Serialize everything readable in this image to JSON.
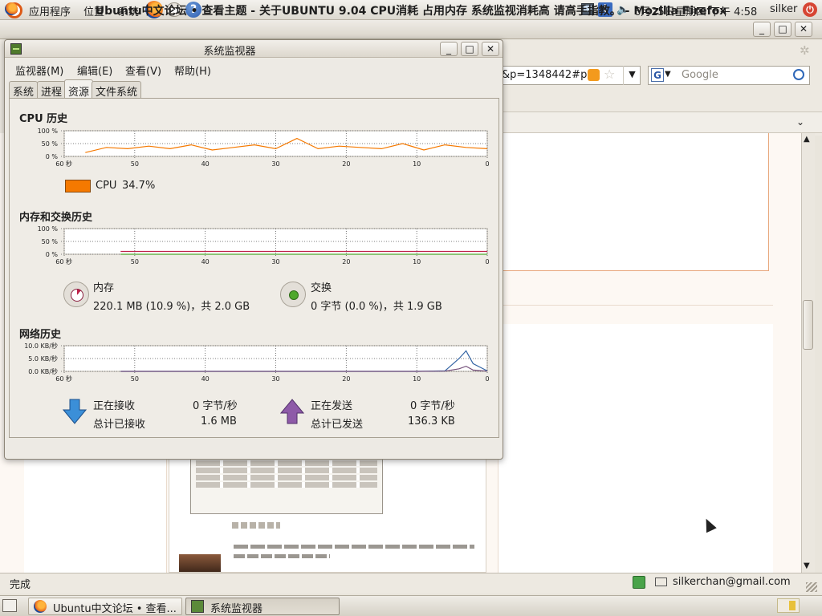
{
  "top_panel": {
    "menus": [
      "应用程序",
      "位置",
      "系统"
    ],
    "help_glyph": "?",
    "info_glyph": "i",
    "clock": "6月25日星期四 下午 4:58",
    "user": "silker",
    "icons": [
      "ubuntu-logo-icon",
      "firefox-icon",
      "mail-icon",
      "help-icon",
      "network-icon",
      "info-icon",
      "volume-icon",
      "power-icon"
    ]
  },
  "firefox": {
    "title": "Ubuntu中文论坛 • 查看主题 - 关于UBUNTU 9.04 CPU消耗 占用内存 系统监视消耗高 请高手指教。 - Mozilla Firefox",
    "url_tail": "&p=1348442#p",
    "search_placeholder": "Google",
    "status_text": "完成",
    "status_email": "silkerchan@gmail.com"
  },
  "window_buttons": {
    "minimize": "_",
    "maximize": "□",
    "close": "✕"
  },
  "taskbar": {
    "items": [
      {
        "label": "Ubuntu中文论坛 • 查看...",
        "active": false
      },
      {
        "label": "系统监视器",
        "active": true
      }
    ]
  },
  "system_monitor": {
    "title": "系统监视器",
    "menus": [
      "监视器(M)",
      "编辑(E)",
      "查看(V)",
      "帮助(H)"
    ],
    "tabs": [
      "系统",
      "进程",
      "资源",
      "文件系统"
    ],
    "active_tab": "资源",
    "cpu": {
      "title": "CPU 历史",
      "legend_label": "CPU",
      "legend_value": "34.7%",
      "color": "#f57900"
    },
    "memory": {
      "title": "内存和交换历史",
      "mem_label": "内存",
      "mem_value": "220.1 MB (10.9 %)，共 2.0 GB",
      "swap_label": "交换",
      "swap_value": "0 字节 (0.0 %)，共 1.9 GB",
      "mem_color": "#c0224b",
      "swap_color": "#4ea82c"
    },
    "network": {
      "title": "网络历史",
      "recv_label": "正在接收",
      "recv_rate": "0 字节/秒",
      "recv_total_label": "总计已接收",
      "recv_total": "1.6 MB",
      "send_label": "正在发送",
      "send_rate": "0 字节/秒",
      "send_total_label": "总计已发送",
      "send_total": "136.3 KB",
      "recv_color": "#3465a4",
      "send_color": "#75507b"
    }
  },
  "chart_data": [
    {
      "type": "line",
      "title": "CPU 历史",
      "x": [
        60,
        57,
        54,
        51,
        48,
        45,
        42,
        39,
        36,
        33,
        30,
        27,
        24,
        21,
        18,
        15,
        12,
        9,
        6,
        3,
        0
      ],
      "series": [
        {
          "name": "CPU",
          "values": [
            null,
            15,
            35,
            30,
            40,
            30,
            45,
            25,
            35,
            45,
            30,
            70,
            30,
            40,
            35,
            30,
            50,
            25,
            45,
            35,
            30
          ]
        }
      ],
      "xlabel": "",
      "ylabel": "",
      "x_tick_labels": [
        "60 秒",
        "50",
        "40",
        "30",
        "20",
        "10",
        "0"
      ],
      "y_tick_labels": [
        "100 %",
        "50 %",
        "0 %"
      ],
      "xlim": [
        60,
        0
      ],
      "ylim": [
        0,
        100
      ],
      "grid": true
    },
    {
      "type": "line",
      "title": "内存和交换历史",
      "x": [
        60,
        52,
        0
      ],
      "series": [
        {
          "name": "内存",
          "values": [
            null,
            10.9,
            10.9
          ]
        },
        {
          "name": "交换",
          "values": [
            null,
            0,
            0
          ]
        }
      ],
      "x_tick_labels": [
        "60 秒",
        "50",
        "40",
        "30",
        "20",
        "10",
        "0"
      ],
      "y_tick_labels": [
        "100 %",
        "50 %",
        "0 %"
      ],
      "xlim": [
        60,
        0
      ],
      "ylim": [
        0,
        100
      ],
      "grid": true
    },
    {
      "type": "line",
      "title": "网络历史",
      "x": [
        60,
        52,
        10,
        6,
        4,
        3,
        2,
        0
      ],
      "series": [
        {
          "name": "正在接收",
          "values": [
            null,
            0,
            0,
            0.2,
            5.0,
            8.0,
            3.0,
            0.2
          ]
        },
        {
          "name": "正在发送",
          "values": [
            null,
            0,
            0,
            0.1,
            1.0,
            2.0,
            0.5,
            0.1
          ]
        }
      ],
      "x_tick_labels": [
        "60 秒",
        "50",
        "40",
        "30",
        "20",
        "10",
        "0"
      ],
      "y_tick_labels": [
        "10.0 KB/秒",
        "5.0 KB/秒",
        "0.0 KB/秒"
      ],
      "xlim": [
        60,
        0
      ],
      "ylim": [
        0,
        10
      ],
      "grid": true
    }
  ]
}
